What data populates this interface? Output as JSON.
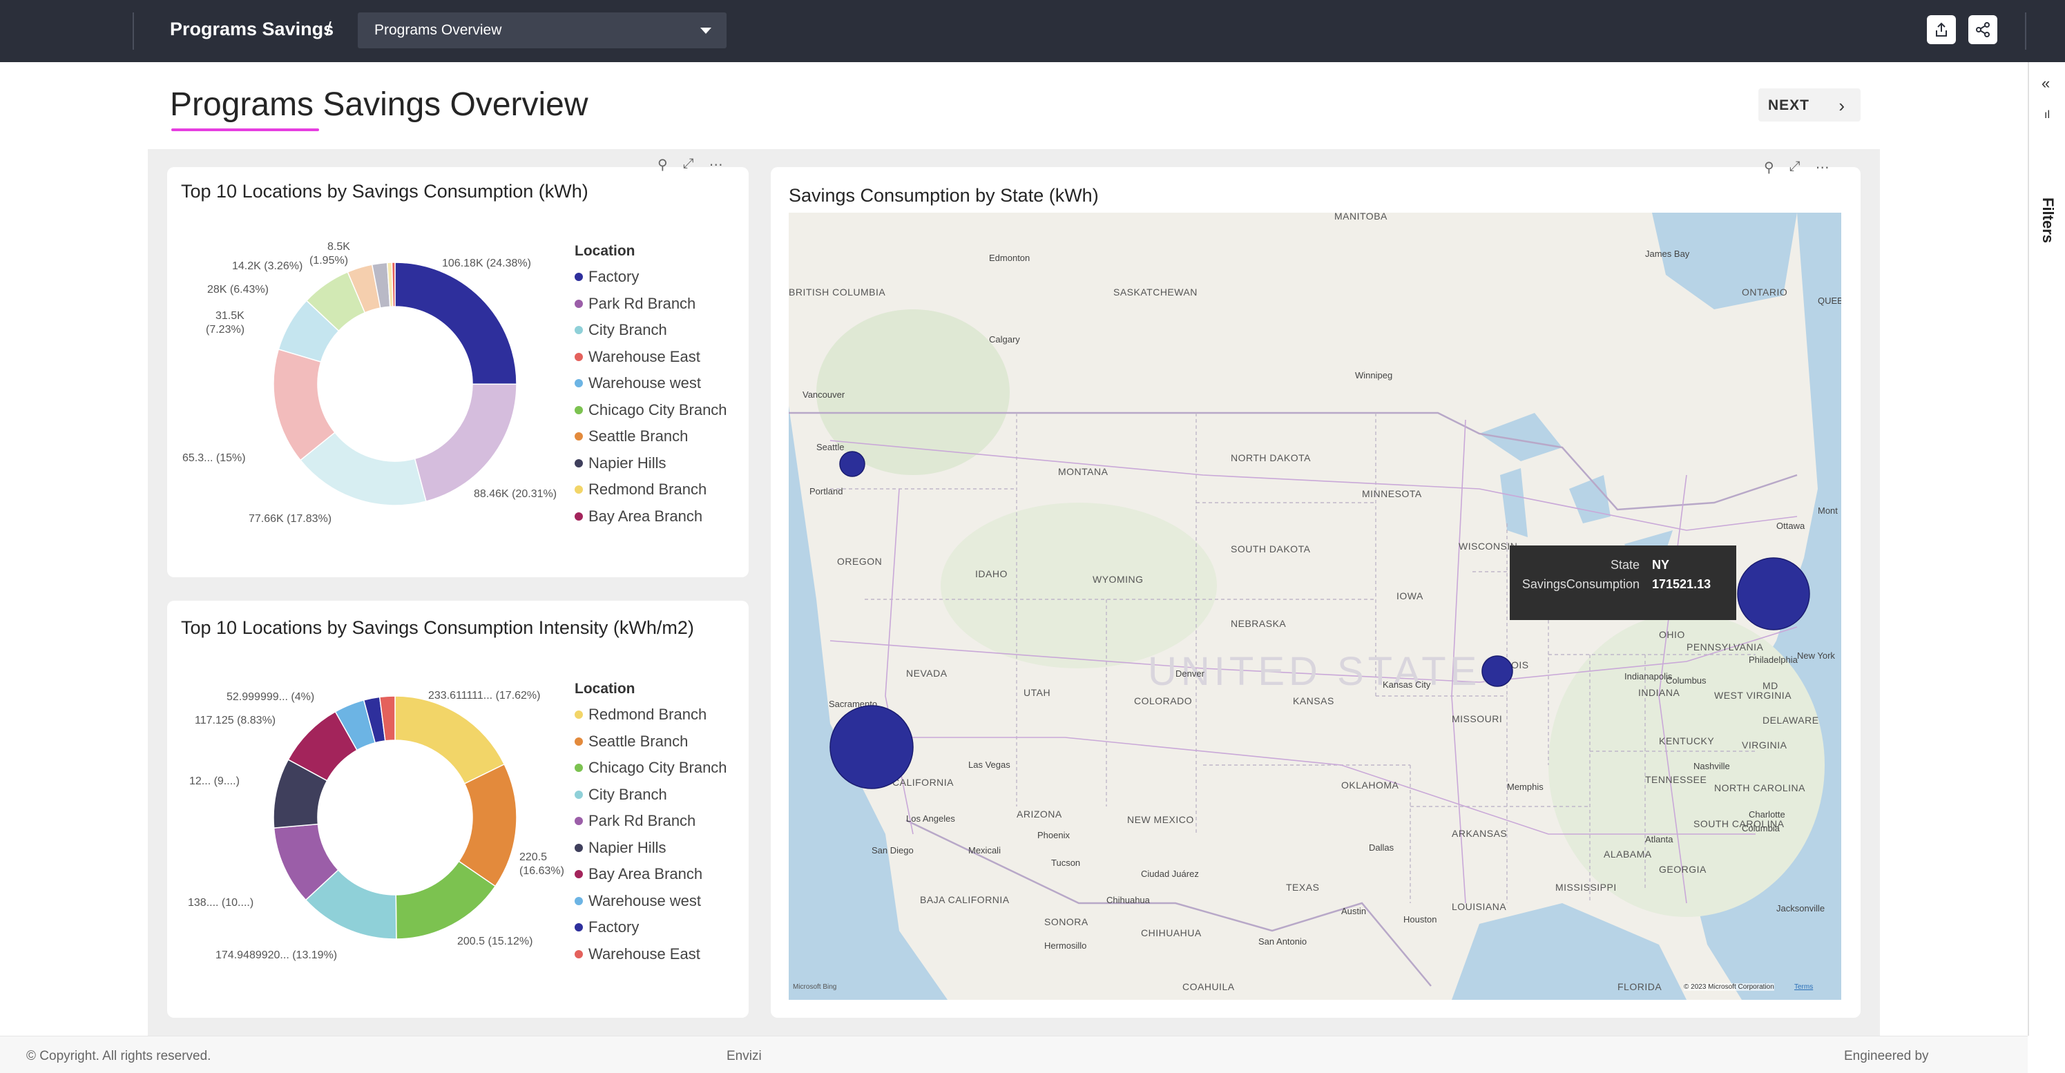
{
  "topbar": {
    "brand": "Programs Savings",
    "separator": "/",
    "page_select": "Programs Overview",
    "export_icon": "export-icon",
    "share_icon": "share-icon"
  },
  "rail": {
    "collapse_icon": "chevron-double-left-icon",
    "label": "Filters"
  },
  "page": {
    "title": "Programs Savings Overview",
    "next_label": "NEXT",
    "accent": "#e63ee0"
  },
  "donut1": {
    "title": "Top 10 Locations by Savings Consumption (kWh)",
    "legend_title": "Location",
    "legend": [
      {
        "name": "Factory",
        "color": "#2e2f9c"
      },
      {
        "name": "Park Rd Branch",
        "color": "#9b5ea8"
      },
      {
        "name": "City Branch",
        "color": "#8fd0d8"
      },
      {
        "name": "Warehouse East",
        "color": "#e4615c"
      },
      {
        "name": "Warehouse west",
        "color": "#6cb4e4"
      },
      {
        "name": "Chicago City Branch",
        "color": "#7cc250"
      },
      {
        "name": "Seattle Branch",
        "color": "#e38a3c"
      },
      {
        "name": "Napier Hills",
        "color": "#3f3f5c"
      },
      {
        "name": "Redmond Branch",
        "color": "#f2d568"
      },
      {
        "name": "Bay Area Branch",
        "color": "#a3245b"
      }
    ],
    "labels": [
      "106.18K (24.38%)",
      "88.46K (20.31%)",
      "77.66K (17.83%)",
      "65.3... (15%)",
      "31.5K",
      "(7.23%)",
      "28K (6.43%)",
      "14.2K (3.26%)",
      "8.5K",
      "(1.95%)"
    ]
  },
  "donut2": {
    "title": "Top 10 Locations by Savings Consumption Intensity (kWh/m2)",
    "legend_title": "Location",
    "legend": [
      {
        "name": "Redmond Branch",
        "color": "#f2d568"
      },
      {
        "name": "Seattle Branch",
        "color": "#e38a3c"
      },
      {
        "name": "Chicago City Branch",
        "color": "#7cc250"
      },
      {
        "name": "City Branch",
        "color": "#8fd0d8"
      },
      {
        "name": "Park Rd Branch",
        "color": "#9b5ea8"
      },
      {
        "name": "Napier Hills",
        "color": "#3f3f5c"
      },
      {
        "name": "Bay Area Branch",
        "color": "#a3245b"
      },
      {
        "name": "Warehouse west",
        "color": "#6cb4e4"
      },
      {
        "name": "Factory",
        "color": "#2e2f9c"
      },
      {
        "name": "Warehouse East",
        "color": "#e4615c"
      }
    ],
    "labels": [
      "233.611111... (17.62%)",
      "220.5",
      "(16.63%)",
      "200.5 (15.12%)",
      "174.9489920... (13.19%)",
      "138.... (10....)",
      "12... (9....)",
      "117.125 (8.83%)",
      "52.999999... (4%)"
    ]
  },
  "map": {
    "title": "Savings Consumption by State (kWh)",
    "regions": [
      "MANITOBA",
      "SASKATCHEWAN",
      "ONTARIO",
      "BRITISH COLUMBIA",
      "MONTANA",
      "NORTH DAKOTA",
      "MINNESOTA",
      "SOUTH DAKOTA",
      "WISCONSIN",
      "OREGON",
      "IDAHO",
      "WYOMING",
      "IOWA",
      "NEBRASKA",
      "NEVADA",
      "UTAH",
      "COLORADO",
      "KANSAS",
      "MISSOURI",
      "ILLINOIS",
      "INDIANA",
      "OHIO",
      "PENNSYLVANIA",
      "WEST VIRGINIA",
      "VIRGINIA",
      "KENTUCKY",
      "TENNESSEE",
      "NORTH CAROLINA",
      "SOUTH CAROLINA",
      "GEORGIA",
      "ALABAMA",
      "MISSISSIPPI",
      "ARKANSAS",
      "OKLAHOMA",
      "TEXAS",
      "LOUISIANA",
      "NEW MEXICO",
      "ARIZONA",
      "CALIFORNIA",
      "BAJA CALIFORNIA",
      "SONORA",
      "CHIHUAHUA",
      "COAHUILA",
      "FLORIDA",
      "DELAWARE",
      "MD",
      "UNITED STATES"
    ],
    "cities": [
      "Edmonton",
      "Calgary",
      "Vancouver",
      "Seattle",
      "Portland",
      "Winnipeg",
      "Sacramento",
      "Las Vegas",
      "Los Angeles",
      "San Diego",
      "Phoenix",
      "Tucson",
      "Mexicali",
      "Hermosillo",
      "Chihuahua",
      "Ciudad Juárez",
      "Denver",
      "Kansas City",
      "Indianapolis",
      "Columbus",
      "Philadelphia",
      "New York",
      "Ottawa",
      "Nashville",
      "Memphis",
      "Charlotte",
      "Columbia",
      "Atlanta",
      "Jacksonville",
      "Dallas",
      "Austin",
      "Houston",
      "San Antonio",
      "James Bay",
      "QUEBEC",
      "Mont"
    ],
    "tooltip": {
      "state_label": "State",
      "state_value": "NY",
      "metric_label": "SavingsConsumption",
      "metric_value": "171521.13"
    },
    "attribution_left": "Microsoft Bing",
    "attribution_right": "© 2023 Microsoft Corporation",
    "terms": "Terms",
    "bubble_color": "#2b2f99"
  },
  "footer": {
    "copyright": "© Copyright. All rights reserved.",
    "center": "Envizi",
    "right": "Engineered by"
  }
}
